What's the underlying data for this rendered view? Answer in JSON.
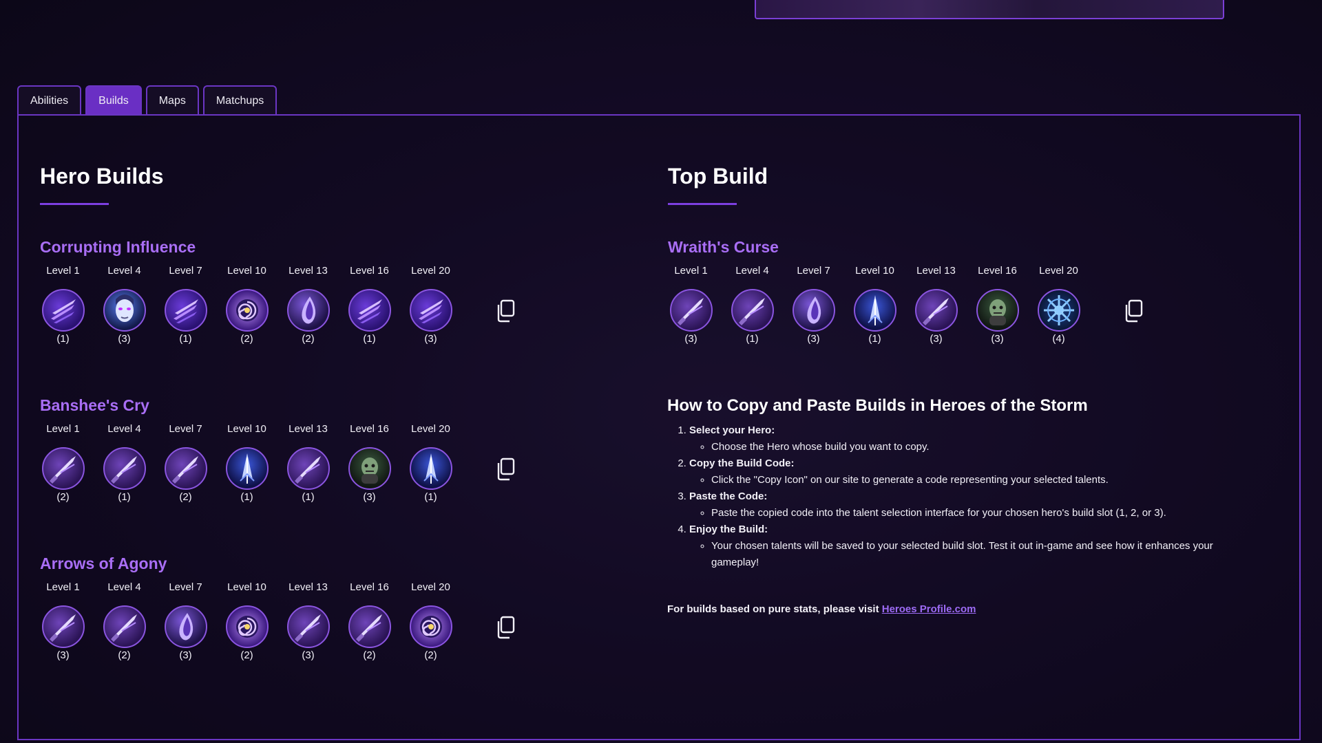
{
  "tabs": [
    {
      "label": "Abilities",
      "active": false
    },
    {
      "label": "Builds",
      "active": true
    },
    {
      "label": "Maps",
      "active": false
    },
    {
      "label": "Matchups",
      "active": false
    }
  ],
  "hero_builds": {
    "title": "Hero Builds",
    "builds": [
      {
        "name": "Corrupting Influence",
        "talents": [
          {
            "level": "Level 1",
            "rank": "(1)",
            "icon": "claw-talent-icon"
          },
          {
            "level": "Level 4",
            "rank": "(3)",
            "icon": "banshee-face-talent-icon"
          },
          {
            "level": "Level 7",
            "rank": "(1)",
            "icon": "claw-talent-icon"
          },
          {
            "level": "Level 10",
            "rank": "(2)",
            "icon": "spiral-eye-talent-icon"
          },
          {
            "level": "Level 13",
            "rank": "(2)",
            "icon": "drop-talent-icon"
          },
          {
            "level": "Level 16",
            "rank": "(1)",
            "icon": "claw-talent-icon"
          },
          {
            "level": "Level 20",
            "rank": "(3)",
            "icon": "claw-talent-icon"
          }
        ]
      },
      {
        "name": "Banshee's Cry",
        "talents": [
          {
            "level": "Level 1",
            "rank": "(2)",
            "icon": "blade-talent-icon"
          },
          {
            "level": "Level 4",
            "rank": "(1)",
            "icon": "blade-talent-icon"
          },
          {
            "level": "Level 7",
            "rank": "(2)",
            "icon": "blade-talent-icon"
          },
          {
            "level": "Level 10",
            "rank": "(1)",
            "icon": "arrow-talent-icon"
          },
          {
            "level": "Level 13",
            "rank": "(1)",
            "icon": "blade-talent-icon"
          },
          {
            "level": "Level 16",
            "rank": "(3)",
            "icon": "ghoul-talent-icon"
          },
          {
            "level": "Level 20",
            "rank": "(1)",
            "icon": "arrow-talent-icon"
          }
        ]
      },
      {
        "name": "Arrows of Agony",
        "talents": [
          {
            "level": "Level 1",
            "rank": "(3)",
            "icon": "blade-talent-icon"
          },
          {
            "level": "Level 4",
            "rank": "(2)",
            "icon": "blade-talent-icon"
          },
          {
            "level": "Level 7",
            "rank": "(3)",
            "icon": "drop-talent-icon"
          },
          {
            "level": "Level 10",
            "rank": "(2)",
            "icon": "spiral-eye-talent-icon"
          },
          {
            "level": "Level 13",
            "rank": "(3)",
            "icon": "blade-talent-icon"
          },
          {
            "level": "Level 16",
            "rank": "(2)",
            "icon": "blade-talent-icon"
          },
          {
            "level": "Level 20",
            "rank": "(2)",
            "icon": "spiral-eye-talent-icon"
          }
        ]
      }
    ]
  },
  "top_build": {
    "title": "Top Build",
    "name": "Wraith's Curse",
    "talents": [
      {
        "level": "Level 1",
        "rank": "(3)",
        "icon": "blade-talent-icon"
      },
      {
        "level": "Level 4",
        "rank": "(1)",
        "icon": "blade-talent-icon"
      },
      {
        "level": "Level 7",
        "rank": "(3)",
        "icon": "drop-talent-icon"
      },
      {
        "level": "Level 10",
        "rank": "(1)",
        "icon": "arrow-talent-icon"
      },
      {
        "level": "Level 13",
        "rank": "(3)",
        "icon": "blade-talent-icon"
      },
      {
        "level": "Level 16",
        "rank": "(3)",
        "icon": "ghoul-talent-icon"
      },
      {
        "level": "Level 20",
        "rank": "(4)",
        "icon": "star-talent-icon"
      }
    ]
  },
  "howto": {
    "title": "How to Copy and Paste Builds in Heroes of the Storm",
    "steps": [
      {
        "heading": "Select your Hero:",
        "detail": "Choose the Hero whose build you want to copy."
      },
      {
        "heading": "Copy the Build Code:",
        "detail": "Click the \"Copy Icon\" on our site to generate a code representing your selected talents."
      },
      {
        "heading": "Paste the Code:",
        "detail": "Paste the copied code into the talent selection interface for your chosen hero's build slot (1, 2, or 3)."
      },
      {
        "heading": "Enjoy the Build:",
        "detail": "Your chosen talents will be saved to your selected build slot. Test it out in-game and see how it enhances your gameplay!"
      }
    ]
  },
  "note": {
    "text": "For builds based on pure stats, please visit ",
    "link": "Heroes Profile.com"
  },
  "icons": {
    "copy": "copy-icon"
  },
  "colors": {
    "accent": "#6a2fc4",
    "build_name": "#a96ef5",
    "link": "#9d6bf5",
    "border": "#6b36c4"
  }
}
